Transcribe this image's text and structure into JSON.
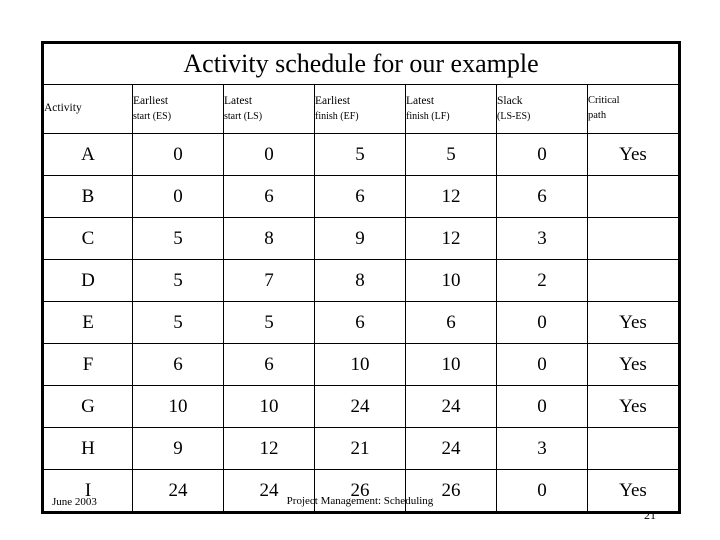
{
  "slide": {
    "title": "Activity schedule for our example"
  },
  "table": {
    "columns": [
      {
        "line1": "Activity",
        "line2": "",
        "uniform": false
      },
      {
        "line1": "Earliest",
        "line2": "start (ES)",
        "uniform": false
      },
      {
        "line1": "Latest",
        "line2": "start (LS)",
        "uniform": false
      },
      {
        "line1": "Earliest",
        "line2": "finish (EF)",
        "uniform": false
      },
      {
        "line1": "Latest",
        "line2": "finish (LF)",
        "uniform": false
      },
      {
        "line1": "Slack",
        "line2": "(LS-ES)",
        "uniform": false
      },
      {
        "line1": "Critical",
        "line2": "path",
        "uniform": true
      }
    ],
    "rows": [
      {
        "activity": "A",
        "es": "0",
        "ls": "0",
        "ef": "5",
        "lf": "5",
        "slack": "0",
        "critical": "Yes"
      },
      {
        "activity": "B",
        "es": "0",
        "ls": "6",
        "ef": "6",
        "lf": "12",
        "slack": "6",
        "critical": ""
      },
      {
        "activity": "C",
        "es": "5",
        "ls": "8",
        "ef": "9",
        "lf": "12",
        "slack": "3",
        "critical": ""
      },
      {
        "activity": "D",
        "es": "5",
        "ls": "7",
        "ef": "8",
        "lf": "10",
        "slack": "2",
        "critical": ""
      },
      {
        "activity": "E",
        "es": "5",
        "ls": "5",
        "ef": "6",
        "lf": "6",
        "slack": "0",
        "critical": "Yes"
      },
      {
        "activity": "F",
        "es": "6",
        "ls": "6",
        "ef": "10",
        "lf": "10",
        "slack": "0",
        "critical": "Yes"
      },
      {
        "activity": "G",
        "es": "10",
        "ls": "10",
        "ef": "24",
        "lf": "24",
        "slack": "0",
        "critical": "Yes"
      },
      {
        "activity": "H",
        "es": "9",
        "ls": "12",
        "ef": "21",
        "lf": "24",
        "slack": "3",
        "critical": ""
      },
      {
        "activity": "I",
        "es": "24",
        "ls": "24",
        "ef": "26",
        "lf": "26",
        "slack": "0",
        "critical": "Yes"
      }
    ]
  },
  "footer": {
    "date": "June 2003",
    "center": "Project Management: Scheduling",
    "page": "21"
  },
  "colors": {
    "background": "#ffffff",
    "text": "#000000",
    "border": "#000000"
  }
}
